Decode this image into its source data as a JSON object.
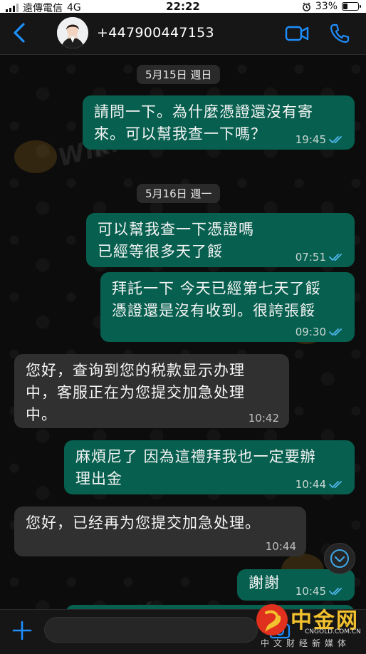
{
  "status_bar": {
    "carrier": "遠傳電信",
    "network": "4G",
    "time": "22:22",
    "battery_percent": "33%",
    "battery_level": 0.33
  },
  "header": {
    "contact_name": "+447900447153",
    "accent_color": "#1f8fff"
  },
  "chat": {
    "date_chips": [
      "5月15日 週日",
      "5月16日 週一"
    ],
    "messages": [
      {
        "direction": "out",
        "text_lines": [
          "請問一下。為什麼憑證還沒有寄",
          "來。可以幫我查一下嗎？"
        ],
        "time": "19:45",
        "read": true
      },
      {
        "direction": "out",
        "text_lines": [
          "可以幫我查一下憑證嗎",
          "已經等很多天了餒"
        ],
        "time": "07:51",
        "read": true
      },
      {
        "direction": "out",
        "text_lines": [
          "拜託一下  今天已經第七天了餒",
          "憑證還是沒有收到。很誇張餒"
        ],
        "time": "09:30",
        "read": true
      },
      {
        "direction": "in",
        "text_lines": [
          "您好，查询到您的税款显示办理",
          "中，客服正在为您提交加急处理",
          "中。"
        ],
        "time": "10:42"
      },
      {
        "direction": "out",
        "text_lines": [
          "麻煩尼了  因為這禮拜我也一定要辦",
          "理出金"
        ],
        "time": "10:44",
        "read": true
      },
      {
        "direction": "in",
        "text_lines": [
          "您好，已经再为您提交加急处理。"
        ],
        "time": "10:44"
      },
      {
        "direction": "out",
        "text_lines": [
          "謝謝"
        ],
        "time": "10:45",
        "read": true
      }
    ],
    "outgoing_color": "#07604f",
    "incoming_color": "#303030",
    "tick_color": "#4fb6ec"
  },
  "watermarks": {
    "wikifx": "WikiFX",
    "cngold_title": "中金网",
    "cngold_url": "CNGOLD.COM.CN",
    "cngold_subtitle": "中文财经新媒体"
  }
}
